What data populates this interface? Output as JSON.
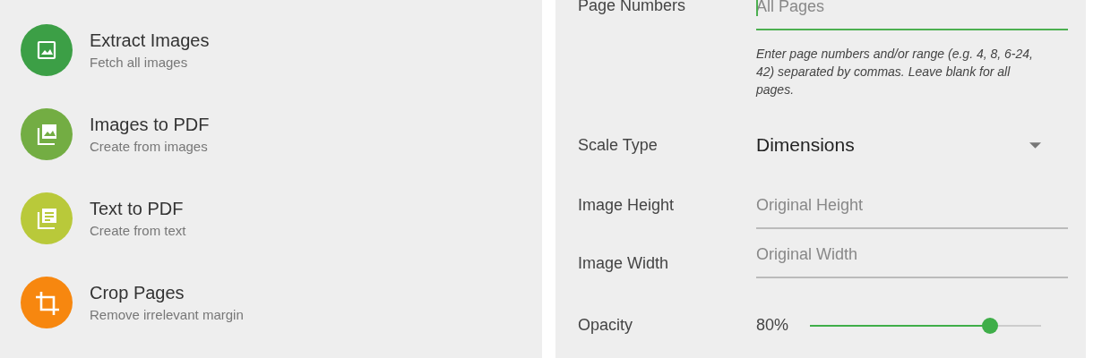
{
  "tools": [
    {
      "title": "Extract Images",
      "subtitle": "Fetch all images",
      "color": "#3c9f46",
      "kind": "image"
    },
    {
      "title": "Images to PDF",
      "subtitle": "Create from images",
      "color": "#73ad43",
      "kind": "images"
    },
    {
      "title": "Text to PDF",
      "subtitle": "Create from text",
      "color": "#b9c93a",
      "kind": "text"
    },
    {
      "title": "Crop Pages",
      "subtitle": "Remove irrelevant margin",
      "color": "#f7870f",
      "kind": "crop"
    }
  ],
  "settings": [
    {
      "kind": "text",
      "label": "Page Numbers",
      "placeholder": "All Pages",
      "focused": true,
      "hint": "Enter page numbers and/or range (e.g. 4, 8, 6-24, 42) separated by commas. Leave blank for all pages."
    },
    {
      "kind": "select",
      "label": "Scale Type",
      "value": "Dimensions"
    },
    {
      "kind": "text",
      "label": "Image Height",
      "placeholder": "Original Height",
      "focused": false
    },
    {
      "kind": "text",
      "label": "Image Width",
      "placeholder": "Original Width",
      "focused": false
    },
    {
      "kind": "slider",
      "label": "Opacity",
      "reading": "80%",
      "level": 0.78
    }
  ]
}
